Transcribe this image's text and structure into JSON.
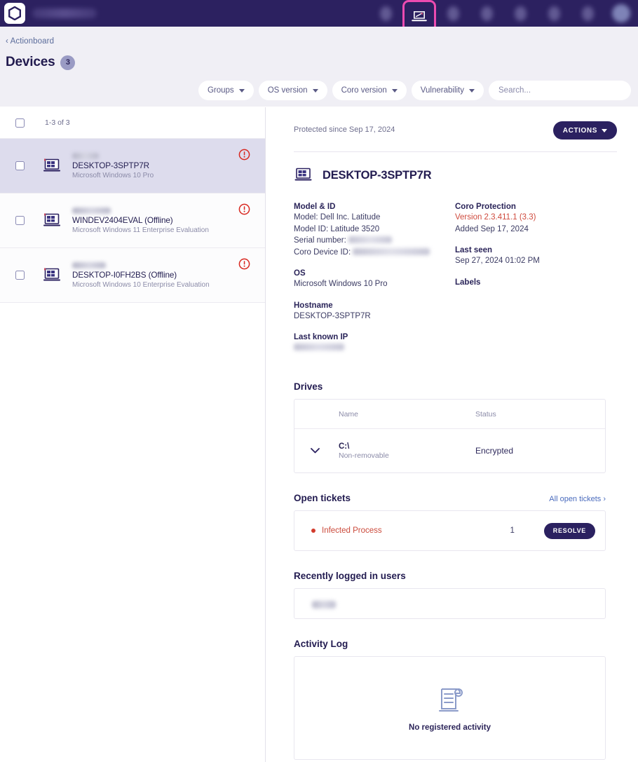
{
  "topnav": {
    "logo_name": "coro-logo",
    "brand_blurred": true,
    "icons": [
      {
        "name": "nav-icon-1",
        "active": false
      },
      {
        "name": "nav-icon-devices",
        "active": true
      },
      {
        "name": "nav-icon-3",
        "active": false
      },
      {
        "name": "nav-icon-4",
        "active": false
      },
      {
        "name": "nav-icon-5",
        "active": false
      },
      {
        "name": "nav-icon-6",
        "active": false
      },
      {
        "name": "nav-icon-7",
        "active": false
      },
      {
        "name": "nav-icon-avatar",
        "active": false
      }
    ],
    "active_highlight_color": "#ec4bb0",
    "background_color": "#2c2160"
  },
  "breadcrumb": {
    "label": "‹ Actionboard"
  },
  "page": {
    "title": "Devices",
    "count": "3"
  },
  "filters": {
    "groups": "Groups",
    "os_version": "OS version",
    "coro_version": "Coro version",
    "vulnerability": "Vulnerability",
    "search_placeholder": "Search...",
    "search_value": ""
  },
  "device_list": {
    "range_label": "1-3 of 3",
    "items": [
      {
        "user_blurred": true,
        "name": "DESKTOP-3SPTP7R",
        "os": "Microsoft Windows 10 Pro",
        "selected": true,
        "alert": true
      },
      {
        "user_blurred": true,
        "name": "WINDEV2404EVAL (Offline)",
        "os": "Microsoft Windows 11 Enterprise Evaluation",
        "selected": false,
        "alert": true
      },
      {
        "user_blurred": true,
        "name": "DESKTOP-I0FH2BS (Offline)",
        "os": "Microsoft Windows 10 Enterprise Evaluation",
        "selected": false,
        "alert": true
      }
    ]
  },
  "detail": {
    "protected_since": "Protected since Sep 17, 2024",
    "actions_label": "ACTIONS",
    "device_name": "DESKTOP-3SPTP7R",
    "model_id": {
      "heading": "Model & ID",
      "model": "Model: Dell Inc. Latitude",
      "model_id": "Model ID: Latitude 3520",
      "serial_label": "Serial number:",
      "coro_device_id_label": "Coro Device ID:"
    },
    "os": {
      "heading": "OS",
      "value": "Microsoft Windows 10 Pro"
    },
    "hostname": {
      "heading": "Hostname",
      "value": "DESKTOP-3SPTP7R"
    },
    "last_known_ip": {
      "heading": "Last known IP"
    },
    "coro_protection": {
      "heading": "Coro Protection",
      "version": "Version 2.3.411.1 (3.3)",
      "version_color": "#cf4a3d",
      "added": "Added Sep 17, 2024"
    },
    "last_seen": {
      "heading": "Last seen",
      "value": "Sep 27, 2024 01:02 PM"
    },
    "labels": {
      "heading": "Labels"
    },
    "drives": {
      "heading": "Drives",
      "columns": [
        "Name",
        "Status"
      ],
      "rows": [
        {
          "name": "C:\\",
          "type": "Non-removable",
          "status": "Encrypted"
        }
      ]
    },
    "open_tickets": {
      "heading": "Open tickets",
      "all_link": "All open tickets ›",
      "rows": [
        {
          "name": "Infected Process",
          "count": "1",
          "action": "RESOLVE",
          "dot_color": "#d23b2c"
        }
      ]
    },
    "recent_users": {
      "heading": "Recently logged in users",
      "user_blurred": true
    },
    "activity_log": {
      "heading": "Activity Log",
      "empty_text": "No registered activity",
      "empty_icon": "scroll-document-icon"
    }
  }
}
